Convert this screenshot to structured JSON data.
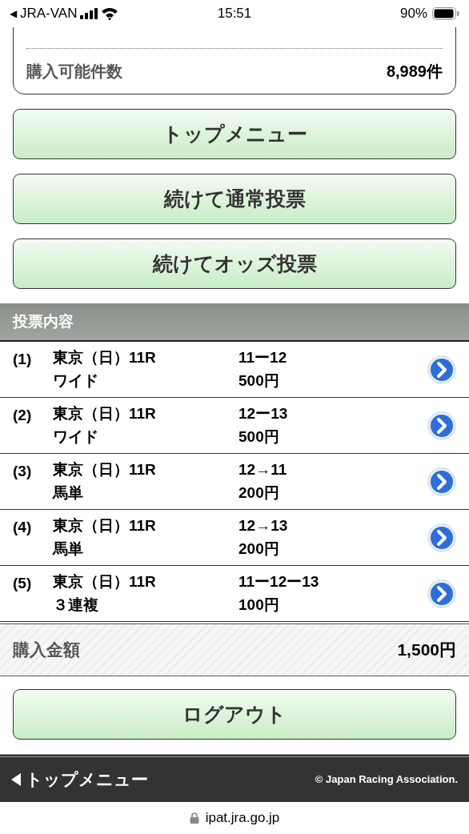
{
  "status_bar": {
    "back": "◀",
    "carrier": "JRA-VAN",
    "time": "15:51",
    "battery": "90%"
  },
  "summary": [
    {
      "label": "購入可能件数",
      "value": "8,989件"
    }
  ],
  "buttons": [
    "トップメニュー",
    "続けて通常投票",
    "続けてオッズ投票"
  ],
  "section_title": "投票内容",
  "bets": [
    {
      "index": "(1)",
      "race": "東京（日）11R",
      "type": "ワイド",
      "combination": "11ー12",
      "amount": "500円"
    },
    {
      "index": "(2)",
      "race": "東京（日）11R",
      "type": "ワイド",
      "combination": "12ー13",
      "amount": "500円"
    },
    {
      "index": "(3)",
      "race": "東京（日）11R",
      "type": "馬単",
      "combination": "12→11",
      "amount": "200円"
    },
    {
      "index": "(4)",
      "race": "東京（日）11R",
      "type": "馬単",
      "combination": "12→13",
      "amount": "200円"
    },
    {
      "index": "(5)",
      "race": "東京（日）11R",
      "type": "３連複",
      "combination": "11ー12ー13",
      "amount": "100円"
    }
  ],
  "total": {
    "label": "購入金額",
    "value": "1,500円"
  },
  "logout_button": "ログアウト",
  "footer": {
    "link": "トップメニュー",
    "copyright": "© Japan Racing Association."
  },
  "url": "ipat.jra.go.jp"
}
